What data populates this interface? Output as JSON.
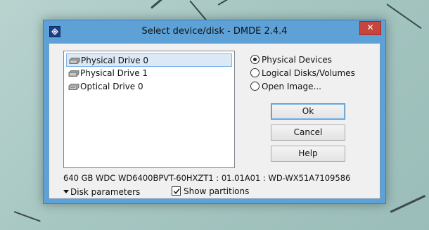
{
  "window": {
    "title": "Select device/disk - DMDE 2.4.4",
    "close_label": "✕",
    "accent_color": "#5da1d7",
    "close_color": "#c7453a"
  },
  "devices": {
    "items": [
      {
        "label": "Physical Drive 0",
        "icon": "hard-drive-icon",
        "selected": true
      },
      {
        "label": "Physical Drive 1",
        "icon": "hard-drive-icon",
        "selected": false
      },
      {
        "label": "Optical Drive 0",
        "icon": "optical-drive-icon",
        "selected": false
      }
    ]
  },
  "source_options": {
    "selected": "Physical Devices",
    "options": [
      {
        "label": "Physical Devices"
      },
      {
        "label": "Logical Disks/Volumes"
      },
      {
        "label": "Open Image..."
      }
    ]
  },
  "buttons": {
    "ok": "Ok",
    "cancel": "Cancel",
    "help": "Help"
  },
  "info": {
    "device_info": "640 GB WDC WD6400BPVT-60HXZT1 : 01.01A01 : WD-WX51A7109586"
  },
  "footer": {
    "disk_parameters": "Disk parameters",
    "show_partitions": "Show partitions",
    "show_partitions_checked": true
  }
}
